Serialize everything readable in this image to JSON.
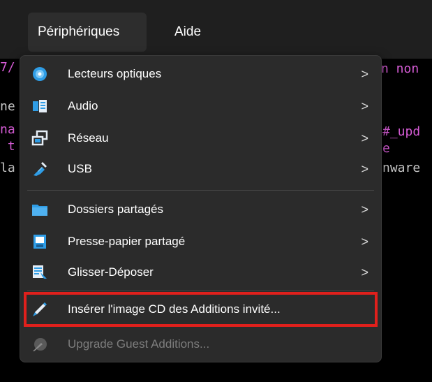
{
  "menubar": {
    "items": [
      {
        "label": "Périphériques",
        "active": true
      },
      {
        "label": "Aide",
        "active": false
      }
    ]
  },
  "background_terminal": {
    "fragments": [
      {
        "text": "7/",
        "color": "#d65cd6"
      },
      {
        "text": "ne",
        "color": "#c8c8c8"
      },
      {
        "text": "na",
        "color": "#d65cd6"
      },
      {
        "text": " t",
        "color": "#d65cd6"
      },
      {
        "text": "la",
        "color": "#c8c8c8"
      },
      {
        "text": "n non",
        "color": "#d65cd6"
      },
      {
        "text": "#_upd",
        "color": "#d65cd6"
      },
      {
        "text": "e",
        "color": "#d65cd6"
      },
      {
        "text": "nware",
        "color": "#c8c8c8"
      }
    ]
  },
  "menu": {
    "groups": [
      [
        {
          "label": "Lecteurs optiques",
          "icon": "optical-disc-icon",
          "submenu": true
        },
        {
          "label": "Audio",
          "icon": "audio-icon",
          "submenu": true
        },
        {
          "label": "Réseau",
          "icon": "network-icon",
          "submenu": true
        },
        {
          "label": "USB",
          "icon": "usb-icon",
          "submenu": true
        }
      ],
      [
        {
          "label": "Dossiers partagés",
          "icon": "shared-folder-icon",
          "submenu": true
        },
        {
          "label": "Presse-papier partagé",
          "icon": "clipboard-icon",
          "submenu": true
        },
        {
          "label": "Glisser-Déposer",
          "icon": "drag-drop-icon",
          "submenu": true
        }
      ],
      [
        {
          "label": "Insérer l'image CD des Additions invité...",
          "icon": "guest-additions-icon",
          "submenu": false,
          "highlighted": true
        },
        {
          "label": "Upgrade Guest Additions...",
          "icon": "upgrade-guest-additions-icon",
          "submenu": false,
          "disabled": true
        }
      ]
    ],
    "submenu_glyph": ">"
  },
  "colors": {
    "menu_bg": "#2b2b2b",
    "highlight_border": "#e0201c",
    "text": "#ffffff",
    "disabled_text": "#7d7d7d"
  }
}
